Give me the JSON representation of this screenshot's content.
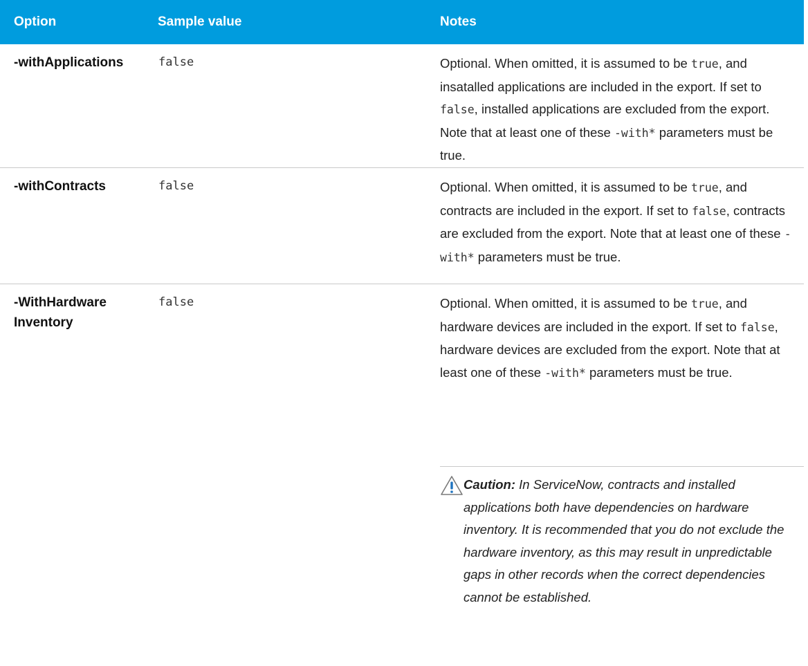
{
  "headers": {
    "option": "Option",
    "sample_value": "Sample value",
    "notes": "Notes"
  },
  "rows": [
    {
      "option": "-withApplications",
      "sample": "false",
      "notes": [
        {
          "t": "Optional. When omitted, it is assumed to be "
        },
        {
          "c": "true"
        },
        {
          "t": ", and insatalled applications are included in the export. If set to "
        },
        {
          "c": "false"
        },
        {
          "t": ", installed applications are excluded from the export. Note that at least one of these "
        },
        {
          "c": "-with*"
        },
        {
          "t": " parameters must be true."
        }
      ]
    },
    {
      "option": "-withContracts",
      "sample": "false",
      "notes": [
        {
          "t": "Optional. When omitted, it is assumed to be "
        },
        {
          "c": "true"
        },
        {
          "t": ", and contracts are included in the export. If set to "
        },
        {
          "c": "false"
        },
        {
          "t": ", contracts are excluded from the export. Note that at least one of these "
        },
        {
          "c": "-with*"
        },
        {
          "t": " parameters must be true."
        }
      ]
    },
    {
      "option_line1": "-WithHardware",
      "option_line2": "Inventory",
      "sample": "false",
      "notes": [
        {
          "t": "Optional. When omitted, it is assumed to be "
        },
        {
          "c": "true"
        },
        {
          "t": ", and hardware devices are included in the export. If set to "
        },
        {
          "c": "false"
        },
        {
          "t": ", hardware devices are excluded from the export. Note that at least one of these "
        },
        {
          "c": "-with*"
        },
        {
          "t": " parameters must be true."
        }
      ]
    }
  ],
  "caution": {
    "icon": "warning-triangle-icon",
    "label": "Caution:",
    "text": " In ServiceNow, contracts and installed applications both have dependencies on hardware inventory. It is recommended that you do not exclude the hardware inventory, as this may result in unpredictable gaps in other records when the correct dependencies cannot be established."
  },
  "colors": {
    "header_bg": "#009cde",
    "header_text": "#ffffff",
    "row_border": "#c9c9c9",
    "warning_accent": "#1e73be"
  }
}
